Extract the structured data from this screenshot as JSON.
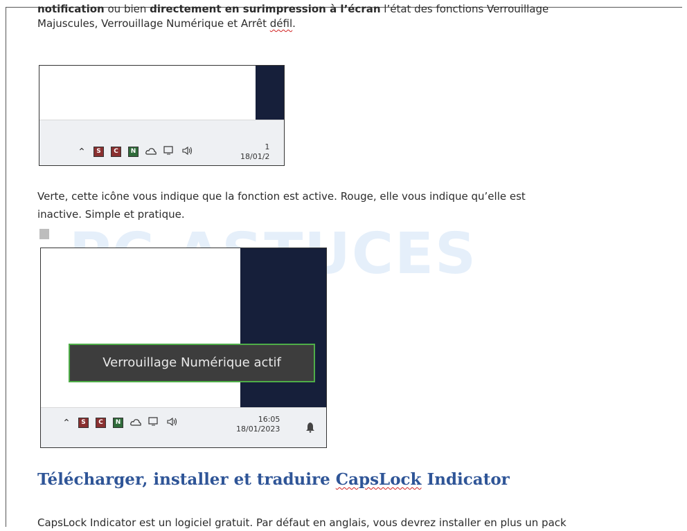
{
  "paragraphs": {
    "p1_bold1": "notification",
    "p1_mid": " ou bien ",
    "p1_bold2": "directement en surimpression à l’écran",
    "p1_rest": " l’état des fonctions Verrouillage",
    "p2_pre": "Majuscules, Verrouillage Numérique et Arrêt ",
    "p2_spell": "défil",
    "p2_end": ".",
    "p3": "Verte, cette icône vous indique que la fonction est active. Rouge, elle vous indique qu’elle est",
    "p4": "inactive. Simple et pratique.",
    "p5": "CapsLock Indicator est un logiciel gratuit. Par défaut en anglais, vous devrez installer en plus un pack"
  },
  "heading": {
    "pre": "Télécharger, installer et traduire ",
    "spell": "CapsLock",
    "post": " Indicator"
  },
  "screenshot1": {
    "tray_icons": [
      "chevron-up-icon",
      "S",
      "C",
      "N",
      "cloud-icon",
      "monitor-icon",
      "speaker-icon"
    ],
    "date": "18/01/2",
    "time": "1"
  },
  "screenshot2": {
    "tooltip": "Verrouillage Numérique actif",
    "time": "16:05",
    "date": "18/01/2023"
  },
  "watermark": {
    "big": "PC ASTUCES",
    "small": "ASTUCES"
  },
  "colors": {
    "heading": "#2f5597",
    "tooltip_border": "#4fae48",
    "taskbar_bg": "#eef0f3",
    "desktop_dark": "#161f3a"
  }
}
